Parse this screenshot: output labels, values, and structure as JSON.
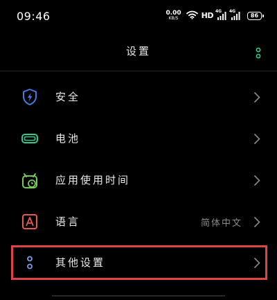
{
  "status_bar": {
    "time": "09:46",
    "net_speed_value": "0.00",
    "net_speed_unit": "KB/S",
    "hd_label": "HD",
    "signal_1_label": "4G",
    "signal_2_label": "4G",
    "battery_level": "86"
  },
  "header": {
    "title": "设置"
  },
  "settings": {
    "items": [
      {
        "label": "安全",
        "icon": "shield-icon",
        "color": "#4a78e0"
      },
      {
        "label": "电池",
        "icon": "battery-icon",
        "color": "#33c98f"
      },
      {
        "label": "应用使用时间",
        "icon": "clock-icon",
        "color": "#79c95a"
      },
      {
        "label": "语言",
        "value": "简体中文",
        "icon": "language-icon",
        "color": "#e85a50"
      },
      {
        "label": "其他设置",
        "icon": "more-settings-icon",
        "color": "#7f9ce8"
      }
    ]
  },
  "colors": {
    "background": "#000000",
    "highlight_border": "#e0434a",
    "menu_dots": "#33c98f"
  }
}
